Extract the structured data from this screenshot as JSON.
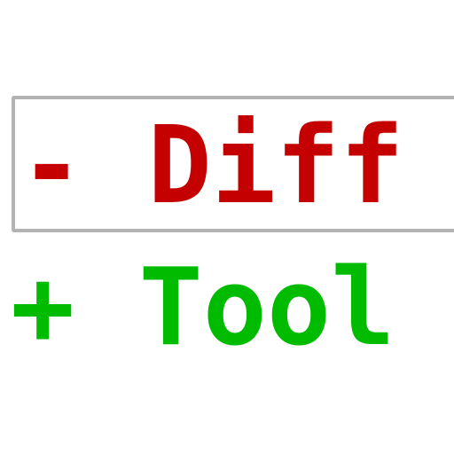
{
  "logo": {
    "removed_line": "- Diff",
    "added_line": "+ Tool",
    "colors": {
      "removed": "#c40000",
      "added": "#00bb00",
      "box_border": "#b3b3b3",
      "background": "#ffffff"
    }
  }
}
